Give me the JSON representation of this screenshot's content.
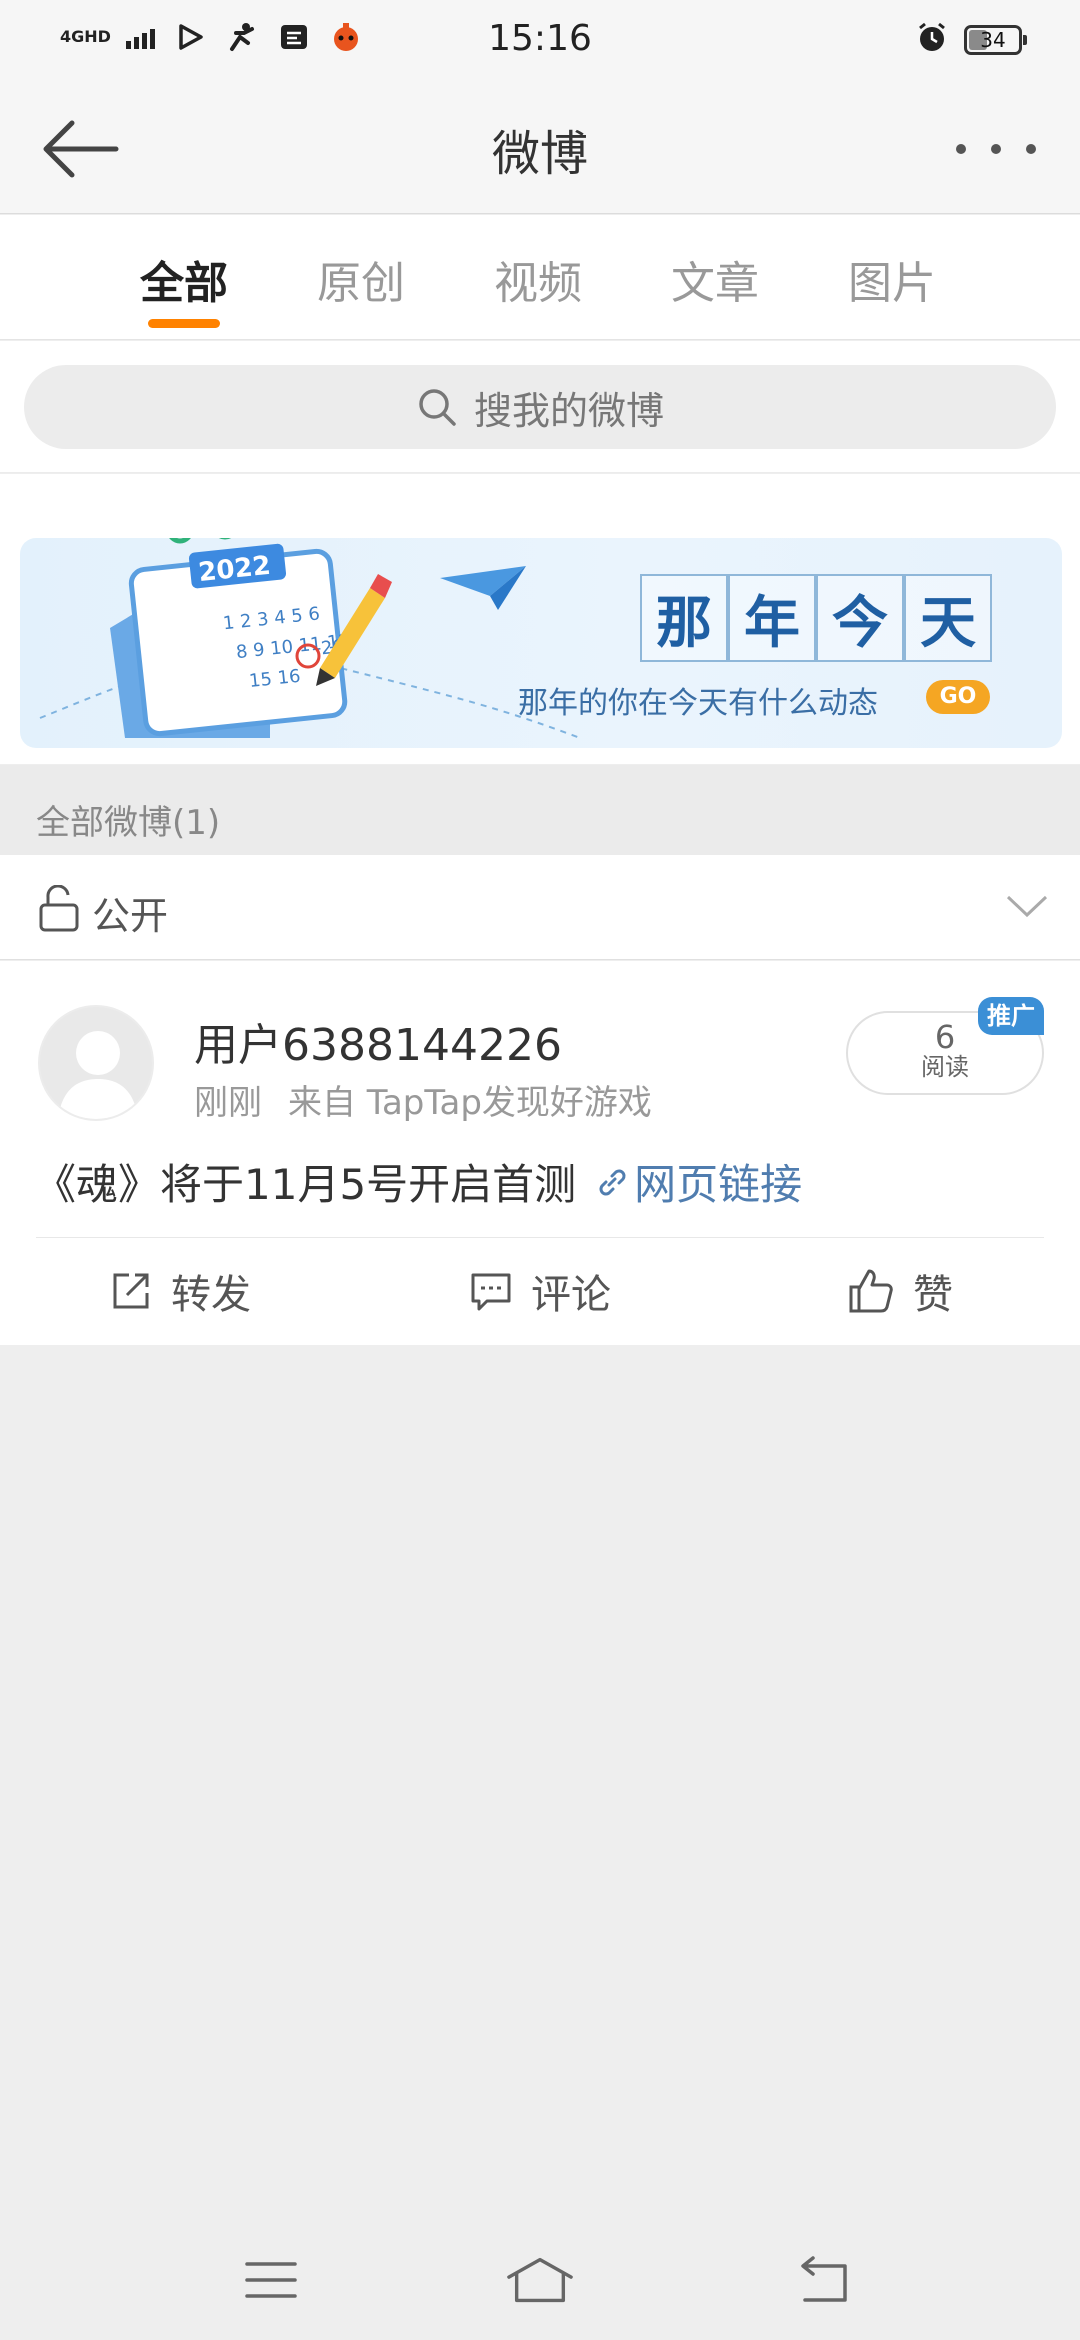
{
  "status_bar": {
    "network": "4GHD",
    "time": "15:16",
    "battery": "34",
    "battery_level": 0.34
  },
  "header": {
    "title": "微博"
  },
  "tabs": [
    {
      "label": "全部",
      "active": true
    },
    {
      "label": "原创",
      "active": false
    },
    {
      "label": "视频",
      "active": false
    },
    {
      "label": "文章",
      "active": false
    },
    {
      "label": "图片",
      "active": false
    }
  ],
  "search": {
    "placeholder": "搜我的微博"
  },
  "banner": {
    "title_chars": [
      "那",
      "年",
      "今",
      "天"
    ],
    "subtitle": "那年的你在今天有什么动态",
    "go_label": "GO",
    "calendar_year": "2022"
  },
  "section": {
    "label": "全部微博(1)"
  },
  "privacy": {
    "label": "公开"
  },
  "post": {
    "username": "用户6388144226",
    "time": "刚刚",
    "source": "来自 TapTap发现好游戏",
    "read_count": "6",
    "read_label": "阅读",
    "badge": "推广",
    "text": "《魂》将于11月5号开启首测",
    "link_text": "网页链接"
  },
  "actions": {
    "repost": "转发",
    "comment": "评论",
    "like": "赞"
  },
  "colors": {
    "accent": "#ff8200",
    "link": "#507daf",
    "badge": "#3b8fd6"
  }
}
